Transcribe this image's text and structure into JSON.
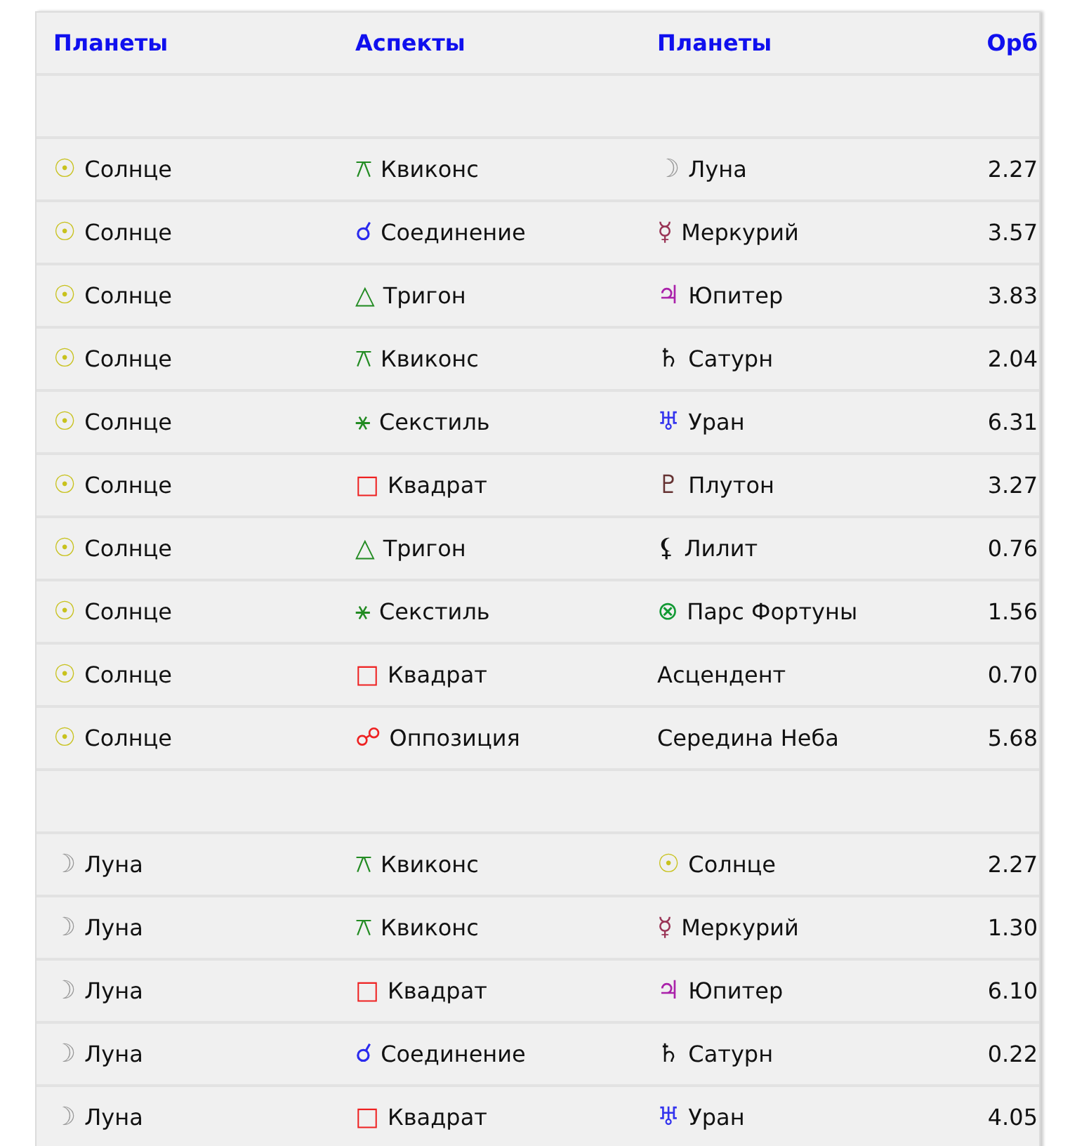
{
  "table": {
    "columns": [
      "Планеты",
      "Аспекты",
      "Планеты",
      "Орб"
    ],
    "rows": [
      {
        "kind": "spacer"
      },
      {
        "kind": "aspect",
        "planet1": {
          "symbol": "☉",
          "color": "#c8c21e",
          "name": "Солнце"
        },
        "aspect": {
          "symbol": "⚻",
          "color": "#228b22",
          "name": "Квиконс"
        },
        "planet2": {
          "symbol": "☽",
          "color": "#999999",
          "name": "Луна"
        },
        "orb": "2.27"
      },
      {
        "kind": "aspect",
        "planet1": {
          "symbol": "☉",
          "color": "#c8c21e",
          "name": "Солнце"
        },
        "aspect": {
          "symbol": "☌",
          "color": "#2a2aee",
          "name": "Соединение"
        },
        "planet2": {
          "symbol": "☿",
          "color": "#993355",
          "name": "Меркурий"
        },
        "orb": "3.57"
      },
      {
        "kind": "aspect",
        "planet1": {
          "symbol": "☉",
          "color": "#c8c21e",
          "name": "Солнце"
        },
        "aspect": {
          "symbol": "△",
          "color": "#228b22",
          "name": "Тригон"
        },
        "planet2": {
          "symbol": "♃",
          "color": "#aa22aa",
          "name": "Юпитер"
        },
        "orb": "3.83"
      },
      {
        "kind": "aspect",
        "planet1": {
          "symbol": "☉",
          "color": "#c8c21e",
          "name": "Солнце"
        },
        "aspect": {
          "symbol": "⚻",
          "color": "#228b22",
          "name": "Квиконс"
        },
        "planet2": {
          "symbol": "♄",
          "color": "#111111",
          "name": "Сатурн"
        },
        "orb": "2.04"
      },
      {
        "kind": "aspect",
        "planet1": {
          "symbol": "☉",
          "color": "#c8c21e",
          "name": "Солнце"
        },
        "aspect": {
          "symbol": "⚹",
          "color": "#228b22",
          "name": "Секстиль"
        },
        "planet2": {
          "symbol": "♅",
          "color": "#3333ee",
          "name": "Уран"
        },
        "orb": "6.31"
      },
      {
        "kind": "aspect",
        "planet1": {
          "symbol": "☉",
          "color": "#c8c21e",
          "name": "Солнце"
        },
        "aspect": {
          "symbol": "□",
          "color": "#ee2222",
          "name": "Квадрат"
        },
        "planet2": {
          "symbol": "♇",
          "color": "#663333",
          "name": "Плутон"
        },
        "orb": "3.27"
      },
      {
        "kind": "aspect",
        "planet1": {
          "symbol": "☉",
          "color": "#c8c21e",
          "name": "Солнце"
        },
        "aspect": {
          "symbol": "△",
          "color": "#228b22",
          "name": "Тригон"
        },
        "planet2": {
          "symbol": "⚸",
          "color": "#111111",
          "name": "Лилит"
        },
        "orb": "0.76"
      },
      {
        "kind": "aspect",
        "planet1": {
          "symbol": "☉",
          "color": "#c8c21e",
          "name": "Солнце"
        },
        "aspect": {
          "symbol": "⚹",
          "color": "#228b22",
          "name": "Секстиль"
        },
        "planet2": {
          "symbol": "⊗",
          "color": "#119933",
          "name": "Парс Фортуны"
        },
        "orb": "1.56"
      },
      {
        "kind": "aspect",
        "planet1": {
          "symbol": "☉",
          "color": "#c8c21e",
          "name": "Солнце"
        },
        "aspect": {
          "symbol": "□",
          "color": "#ee2222",
          "name": "Квадрат"
        },
        "planet2": {
          "name": "Асцендент"
        },
        "orb": "0.70"
      },
      {
        "kind": "aspect",
        "planet1": {
          "symbol": "☉",
          "color": "#c8c21e",
          "name": "Солнце"
        },
        "aspect": {
          "symbol": "☍",
          "color": "#ee2222",
          "name": "Оппозиция"
        },
        "planet2": {
          "name": "Середина Неба"
        },
        "orb": "5.68"
      },
      {
        "kind": "spacer"
      },
      {
        "kind": "aspect",
        "planet1": {
          "symbol": "☽",
          "color": "#999999",
          "name": "Луна"
        },
        "aspect": {
          "symbol": "⚻",
          "color": "#228b22",
          "name": "Квиконс"
        },
        "planet2": {
          "symbol": "☉",
          "color": "#c8c21e",
          "name": "Солнце"
        },
        "orb": "2.27"
      },
      {
        "kind": "aspect",
        "planet1": {
          "symbol": "☽",
          "color": "#999999",
          "name": "Луна"
        },
        "aspect": {
          "symbol": "⚻",
          "color": "#228b22",
          "name": "Квиконс"
        },
        "planet2": {
          "symbol": "☿",
          "color": "#993355",
          "name": "Меркурий"
        },
        "orb": "1.30"
      },
      {
        "kind": "aspect",
        "planet1": {
          "symbol": "☽",
          "color": "#999999",
          "name": "Луна"
        },
        "aspect": {
          "symbol": "□",
          "color": "#ee2222",
          "name": "Квадрат"
        },
        "planet2": {
          "symbol": "♃",
          "color": "#aa22aa",
          "name": "Юпитер"
        },
        "orb": "6.10"
      },
      {
        "kind": "aspect",
        "planet1": {
          "symbol": "☽",
          "color": "#999999",
          "name": "Луна"
        },
        "aspect": {
          "symbol": "☌",
          "color": "#2a2aee",
          "name": "Соединение"
        },
        "planet2": {
          "symbol": "♄",
          "color": "#111111",
          "name": "Сатурн"
        },
        "orb": "0.22"
      },
      {
        "kind": "aspect",
        "planet1": {
          "symbol": "☽",
          "color": "#999999",
          "name": "Луна"
        },
        "aspect": {
          "symbol": "□",
          "color": "#ee2222",
          "name": "Квадрат"
        },
        "planet2": {
          "symbol": "♅",
          "color": "#3333ee",
          "name": "Уран"
        },
        "orb": "4.05"
      }
    ]
  }
}
